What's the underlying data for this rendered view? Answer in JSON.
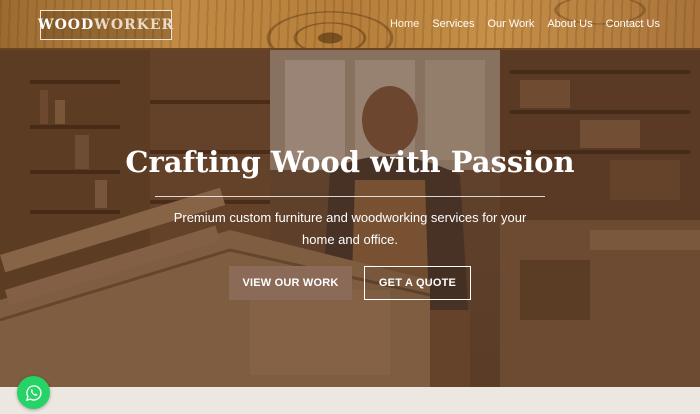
{
  "brand": {
    "logo_part1": "WOOD",
    "logo_part2": "WORKER"
  },
  "nav": {
    "items": [
      "Home",
      "Services",
      "Our Work",
      "About Us",
      "Contact Us"
    ],
    "active": "Home"
  },
  "hero": {
    "title": "Crafting Wood with Passion",
    "subtitle": "Premium custom furniture and woodworking services for your home and office.",
    "primary_button": "VIEW OUR WORK",
    "secondary_button": "GET A QUOTE"
  },
  "icons": {
    "chat": "whatsapp-icon"
  },
  "colors": {
    "accent": "#8b6b58",
    "whatsapp": "#25d366",
    "header_wood": "#c18b45"
  }
}
